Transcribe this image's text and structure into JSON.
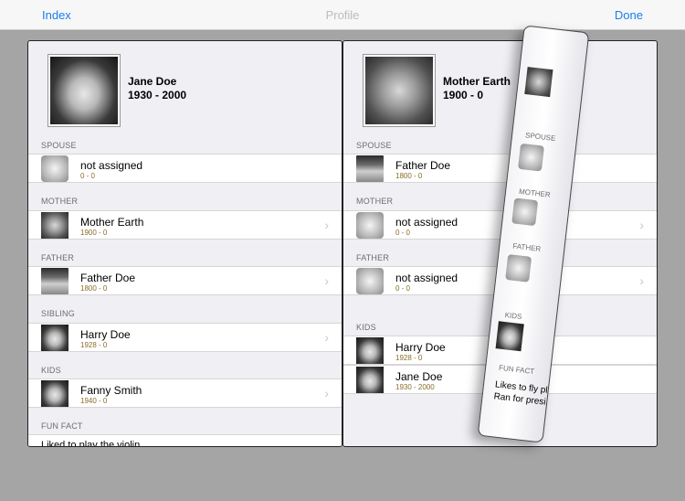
{
  "nav": {
    "left": "Index",
    "title": "Profile",
    "right": "Done"
  },
  "left": {
    "name": "Jane Doe",
    "years": "1930 - 2000",
    "spouse": {
      "label": "SPOUSE",
      "name": "not assigned",
      "years": "0 - 0"
    },
    "mother": {
      "label": "MOTHER",
      "name": "Mother Earth",
      "years": "1900 - 0"
    },
    "father": {
      "label": "FATHER",
      "name": "Father Doe",
      "years": "1800 - 0"
    },
    "sibling": {
      "label": "SIBLING",
      "name": "Harry Doe",
      "years": "1928 - 0"
    },
    "kids": {
      "label": "KIDS",
      "name": "Fanny Smith",
      "years": "1940 - 0"
    },
    "funfact": {
      "label": "FUN FACT",
      "text": "Liked to play the violin"
    }
  },
  "right": {
    "name": "Mother Earth",
    "years": "1900 - 0",
    "spouse": {
      "label": "SPOUSE",
      "name": "Father Doe",
      "years": "1800 - 0"
    },
    "mother": {
      "label": "MOTHER",
      "name": "not assigned",
      "years": "0 - 0"
    },
    "father": {
      "label": "FATHER",
      "name": "not assigned",
      "years": "0 - 0"
    },
    "kids_label": "KIDS",
    "kids": [
      {
        "name": "Harry Doe",
        "years": "1928 - 0"
      },
      {
        "name": "Jane Doe",
        "years": "1930 - 2000"
      }
    ]
  },
  "curl": {
    "spouse": "SPOUSE",
    "mother": "MOTHER",
    "father": "FATHER",
    "kids": "KIDS",
    "funfact": "FUN FACT",
    "line1": "Likes to fly pl",
    "line2": "Ran for presi"
  },
  "icons": {
    "chevron": "›"
  }
}
